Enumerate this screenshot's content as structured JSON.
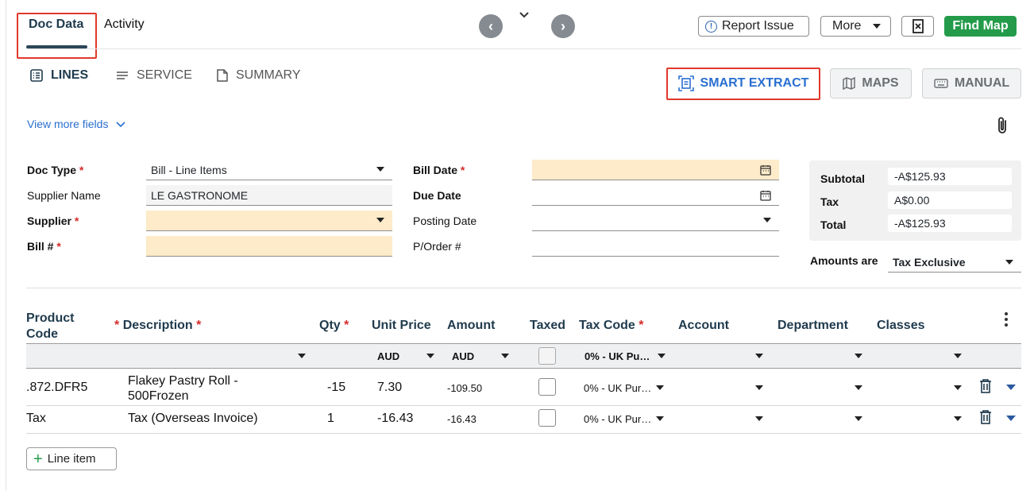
{
  "tabs": {
    "doc_data": "Doc Data",
    "activity": "Activity"
  },
  "nav": {
    "prev": "‹",
    "next": "›",
    "collapse": "⌄"
  },
  "toolbar": {
    "report_issue": "Report Issue",
    "more": "More",
    "find_map": "Find Map"
  },
  "subtabs": {
    "lines": "LINES",
    "service": "SERVICE",
    "summary": "SUMMARY"
  },
  "modes": {
    "smart_extract": "SMART EXTRACT",
    "maps": "MAPS",
    "manual": "MANUAL"
  },
  "view_more": "View more fields",
  "form": {
    "doc_type": {
      "label": "Doc Type",
      "value": "Bill - Line Items"
    },
    "supplier_name": {
      "label": "Supplier Name",
      "value": "LE GASTRONOME"
    },
    "supplier": {
      "label": "Supplier",
      "value": ""
    },
    "bill_no": {
      "label": "Bill #",
      "value": ""
    },
    "bill_date": {
      "label": "Bill Date",
      "value": ""
    },
    "due_date": {
      "label": "Due Date",
      "value": ""
    },
    "posting_date": {
      "label": "Posting Date",
      "value": ""
    },
    "po_no": {
      "label": "P/Order #",
      "value": ""
    }
  },
  "totals": {
    "subtotal_label": "Subtotal",
    "subtotal": "-A$125.93",
    "tax_label": "Tax",
    "tax": "A$0.00",
    "total_label": "Total",
    "total": "-A$125.93",
    "amounts_are_label": "Amounts are",
    "amounts_are": "Tax Exclusive"
  },
  "table": {
    "headers": {
      "product_code_1": "Product",
      "product_code_2": "Code",
      "description": "Description",
      "qty": "Qty",
      "unit_price": "Unit Price",
      "amount": "Amount",
      "taxed": "Taxed",
      "tax_code": "Tax Code",
      "account": "Account",
      "department": "Department",
      "classes": "Classes"
    },
    "filters": {
      "unit_price_currency": "AUD",
      "amount_currency": "AUD",
      "tax_code": "0% - UK Pu…"
    },
    "rows": [
      {
        "code": ".872.DFR5",
        "desc_1": "Flakey Pastry Roll -",
        "desc_2": "500Frozen",
        "qty": "-15",
        "unit_price": "7.30",
        "amount": "-109.50",
        "tax_code": "0% - UK Pur…"
      },
      {
        "code": "Tax",
        "desc_1": "Tax (Overseas Invoice)",
        "desc_2": "",
        "qty": "1",
        "unit_price": "-16.43",
        "amount": "-16.43",
        "tax_code": "0% - UK Pur…"
      }
    ]
  },
  "add_line": "Line item",
  "colors": {
    "accent_blue": "#2a6fd0",
    "green": "#239b4a",
    "highlight_red": "#e0392b",
    "required_yellow": "#fdebc9"
  }
}
